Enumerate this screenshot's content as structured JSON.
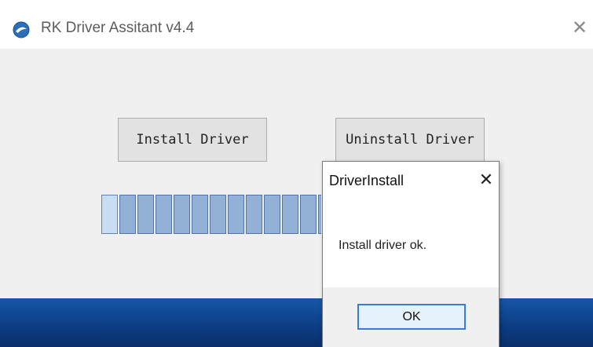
{
  "window": {
    "title": "RK Driver Assitant v4.4",
    "close_glyph": "✕"
  },
  "buttons": {
    "install_label": "Install Driver",
    "uninstall_label": "Uninstall Driver"
  },
  "progress": {
    "visible_segments": 13,
    "colors": {
      "segment": "#93b0d6",
      "segment_border": "#4f74a8",
      "first_segment": "#c8dcf2"
    }
  },
  "dialog": {
    "title": "DriverInstall",
    "close_glyph": "✕",
    "message": "Install driver ok.",
    "ok_label": "OK"
  },
  "icons": {
    "app_icon": "rk-app-icon"
  },
  "colors": {
    "desktop_blue": "#0c3c82",
    "ok_border": "#3a7bd5"
  }
}
